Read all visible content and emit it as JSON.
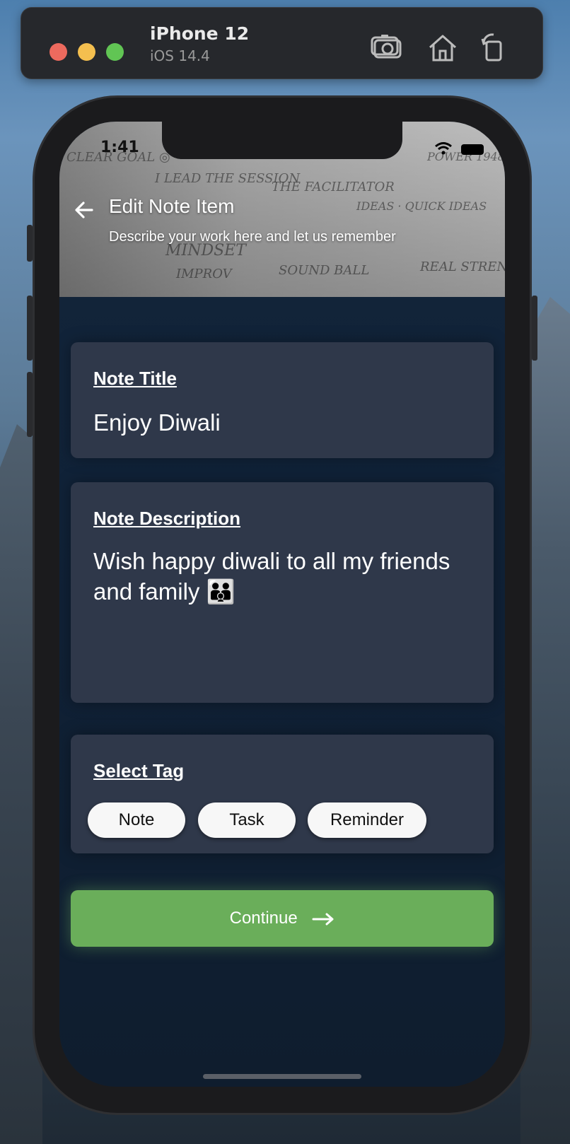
{
  "simulator": {
    "device_name": "iPhone 12",
    "os_version": "iOS 14.4",
    "icons": [
      "traffic-light-close",
      "traffic-light-minimize",
      "traffic-light-zoom",
      "screenshot-icon",
      "home-icon",
      "rotate-icon"
    ]
  },
  "status_bar": {
    "time": "1:41"
  },
  "header": {
    "title": "Edit Note Item",
    "subtitle": "Describe your work here and let us remember",
    "back_icon": "arrow-left-icon"
  },
  "form": {
    "title_label": "Note Title",
    "title_value": "Enjoy Diwali",
    "description_label": "Note Description",
    "description_value": "Wish happy diwali to all my friends and family 👨‍👨‍👦",
    "tag_label": "Select Tag",
    "tags": [
      "Note",
      "Task",
      "Reminder"
    ]
  },
  "actions": {
    "continue_label": "Continue"
  },
  "colors": {
    "background": "#102238",
    "card": "#2f384a",
    "accent_green": "#6aae5a",
    "tag_bg": "#f7f7f7"
  }
}
